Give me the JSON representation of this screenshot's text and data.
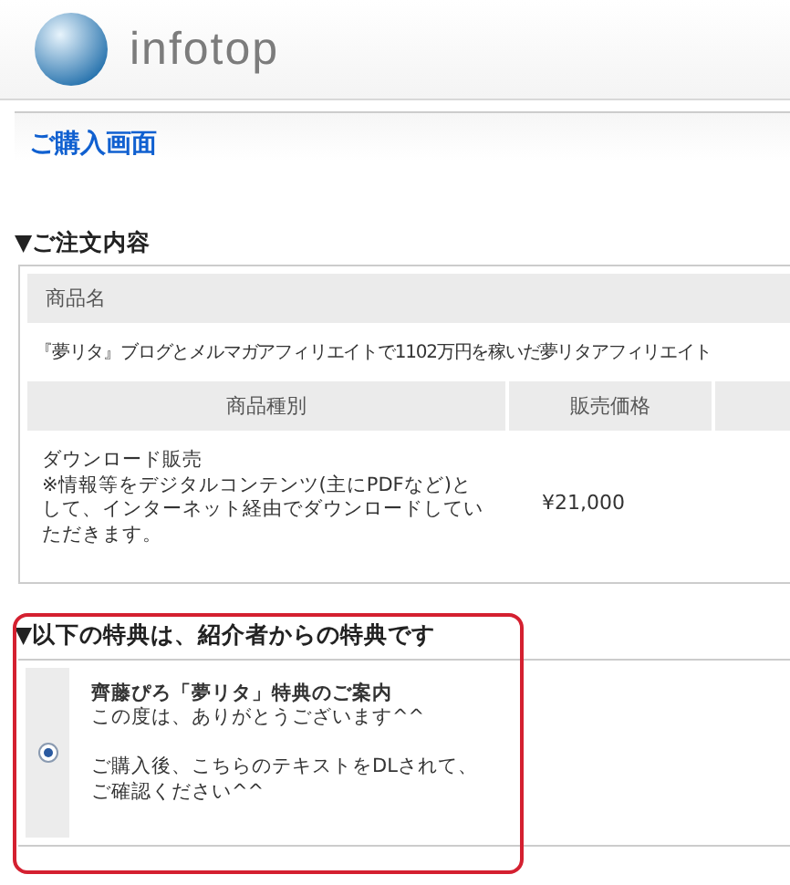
{
  "header": {
    "logo_text": "infotop"
  },
  "page_title": "ご購入画面",
  "order": {
    "heading": "▼ご注文内容",
    "product_label": "商品名",
    "product_name": "『夢リタ』ブログとメルマガアフィリエイトで1102万円を稼いだ夢リタアフィリエイト",
    "columns": [
      "商品種別",
      "販売価格"
    ],
    "rows": [
      {
        "type": "ダウンロード販売\n※情報等をデジタルコンテンツ(主にPDFなど)として、インターネット経由でダウンロードしていただきます。",
        "price": "¥21,000"
      }
    ]
  },
  "bonus": {
    "heading": "▼以下の特典は、紹介者からの特典です",
    "highlighted": true,
    "items": [
      {
        "title": "齊藤ぴろ「夢リタ」特典のご案内",
        "text": "この度は、ありがとうございます^^\n\nご購入後、こちらのテキストをDLされて、ご確認ください^^",
        "selected": true
      }
    ]
  }
}
